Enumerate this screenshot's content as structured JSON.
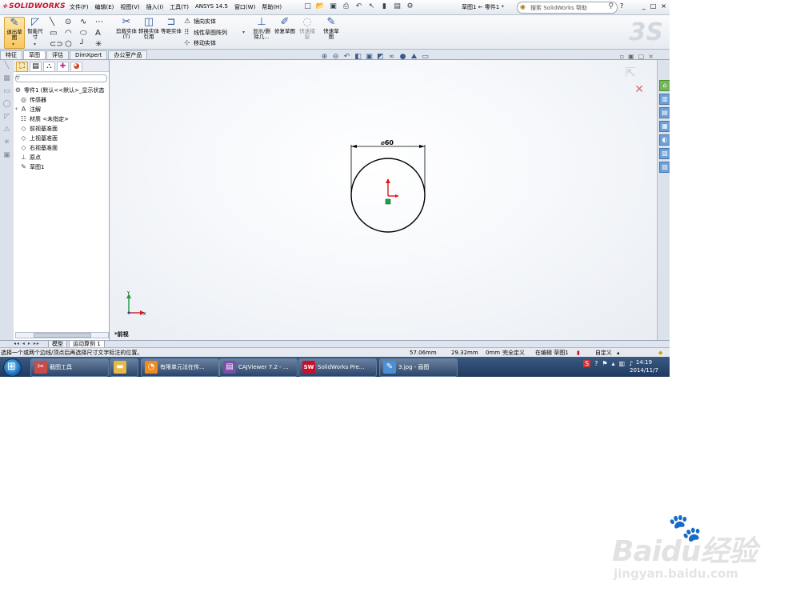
{
  "app": {
    "logo": "SOLIDWORKS",
    "menu": [
      "文件(F)",
      "编辑(E)",
      "视图(V)",
      "插入(I)",
      "工具(T)",
      "ANSYS 14.5",
      "窗口(W)",
      "帮助(H)"
    ],
    "doc_title": "草图1 ← 零件1 *",
    "search_placeholder": "搜索 SolidWorks 帮助",
    "help_btn": "?",
    "window_controls": [
      "_",
      "□",
      "×"
    ]
  },
  "commands": {
    "exit_sketch": "退出草图",
    "smart_dim": "智能尺寸",
    "trim": "剪裁实体(T)",
    "convert": "转换实体引用",
    "offset": "等距实体",
    "mirror": "镜向实体",
    "linear_pattern": "线性草图阵列",
    "move": "移动实体",
    "show_delete": "显示/删除几...",
    "repair": "修复草图",
    "quick_snap": "快速捕捉",
    "rapid_sketch": "快速草图"
  },
  "tabs": [
    {
      "label": "特征",
      "active": false
    },
    {
      "label": "草图",
      "active": true
    },
    {
      "label": "评估",
      "active": false
    },
    {
      "label": "DimXpert",
      "active": false
    },
    {
      "label": "办公室产品",
      "active": false
    }
  ],
  "tree": {
    "root": "零件1 (默认<<默认>_显示状态",
    "items": [
      {
        "label": "传感器",
        "icon": "sensor-icon",
        "expand": ""
      },
      {
        "label": "注解",
        "icon": "annotation-icon",
        "expand": "+"
      },
      {
        "label": "材质 <未指定>",
        "icon": "material-icon",
        "expand": ""
      },
      {
        "label": "前视基准面",
        "icon": "plane-icon",
        "expand": ""
      },
      {
        "label": "上视基准面",
        "icon": "plane-icon",
        "expand": ""
      },
      {
        "label": "右视基准面",
        "icon": "plane-icon",
        "expand": ""
      },
      {
        "label": "原点",
        "icon": "origin-icon",
        "expand": ""
      },
      {
        "label": "草图1",
        "icon": "sketch-icon",
        "expand": ""
      }
    ]
  },
  "sketch": {
    "dimension_label": "⌀60",
    "view_label": "*前视",
    "triad_x": "X",
    "triad_y": "Y"
  },
  "bottom_tabs": [
    {
      "label": "模型",
      "active": false
    },
    {
      "label": "运动算例 1",
      "active": true
    }
  ],
  "status": {
    "hint": "选择一个或两个边线/顶点后再选择尺寸文字标注的位置。",
    "x": "57.06mm",
    "y": "29.32mm",
    "z": "0mm",
    "state": "完全定义",
    "editing": "在编辑 草图1",
    "custom": "自定义"
  },
  "taskbar": {
    "items": [
      {
        "label": "截图工具",
        "color": "#c94a4a"
      },
      {
        "label": "",
        "color": "#e8b84a"
      },
      {
        "label": "有限单元法在传...",
        "color": "#f08a1c"
      },
      {
        "label": "CAJViewer 7.2 - ...",
        "color": "#7a4fa8"
      },
      {
        "label": "SolidWorks Pre...",
        "color": "#c8102e"
      },
      {
        "label": "3.jpg - 画图",
        "color": "#4d8fd4"
      }
    ],
    "time": "14:19",
    "date": "2014/11/7"
  },
  "watermark": {
    "brand": "Baidu经验",
    "url": "jingyan.baidu.com"
  }
}
